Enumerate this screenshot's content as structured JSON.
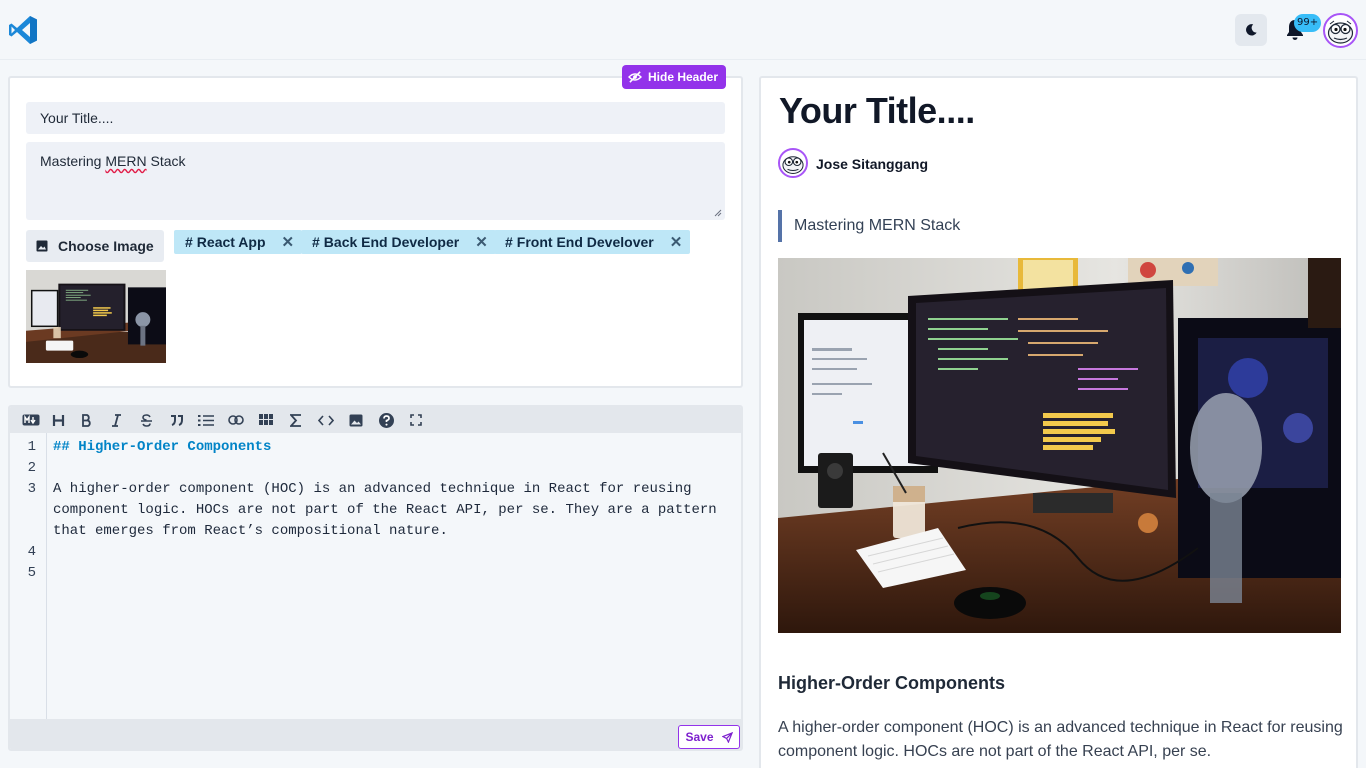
{
  "header": {
    "logo_icon": "vscode-logo-icon",
    "theme_icon": "moon-icon",
    "notifications_icon": "bell-icon",
    "notifications_badge": "99+",
    "avatar_icon": "avatar-face-icon"
  },
  "form": {
    "hide_header_label": "Hide Header",
    "title_placeholder": "Your Title....",
    "subtitle_before": "Mastering ",
    "subtitle_misspelled": "MERN",
    "subtitle_after": " Stack",
    "choose_image_label": "Choose Image",
    "tags": [
      {
        "label": "React App"
      },
      {
        "label": "Back End Developer"
      },
      {
        "label": "Front End Develover"
      }
    ],
    "tag_prefix": "#",
    "tag_remove": "✕"
  },
  "editor": {
    "toolbar": [
      "markdown-icon",
      "heading-icon",
      "bold-icon",
      "italic-icon",
      "strikethrough-icon",
      "quote-icon",
      "list-icon",
      "link-icon",
      "table-icon",
      "formula-icon",
      "code-icon",
      "image-icon",
      "help-icon",
      "fullscreen-icon"
    ],
    "line_numbers": [
      "1",
      "2",
      "3",
      "4",
      "5"
    ],
    "lines": {
      "heading": "## Higher-Order Components",
      "para_1": "A higher-order component (HOC) is an advanced technique in React for reusing",
      "para_2": "component logic. HOCs are not part of the React API, per se. They are a pattern",
      "para_3": "that emerges from React’s compositional nature."
    },
    "save_label": "Save"
  },
  "preview": {
    "title": "Your Title....",
    "author": "Jose Sitanggang",
    "subtitle": "Mastering MERN Stack",
    "heading": "Higher-Order Components",
    "paragraph": "A higher-order component (HOC) is an advanced technique in React for reusing component logic. HOCs are not part of the React API, per se."
  },
  "colors": {
    "accent": "#9333ea",
    "tag_bg": "#bee7f7",
    "heading_code": "#0284c7",
    "badge": "#38bdf8"
  }
}
